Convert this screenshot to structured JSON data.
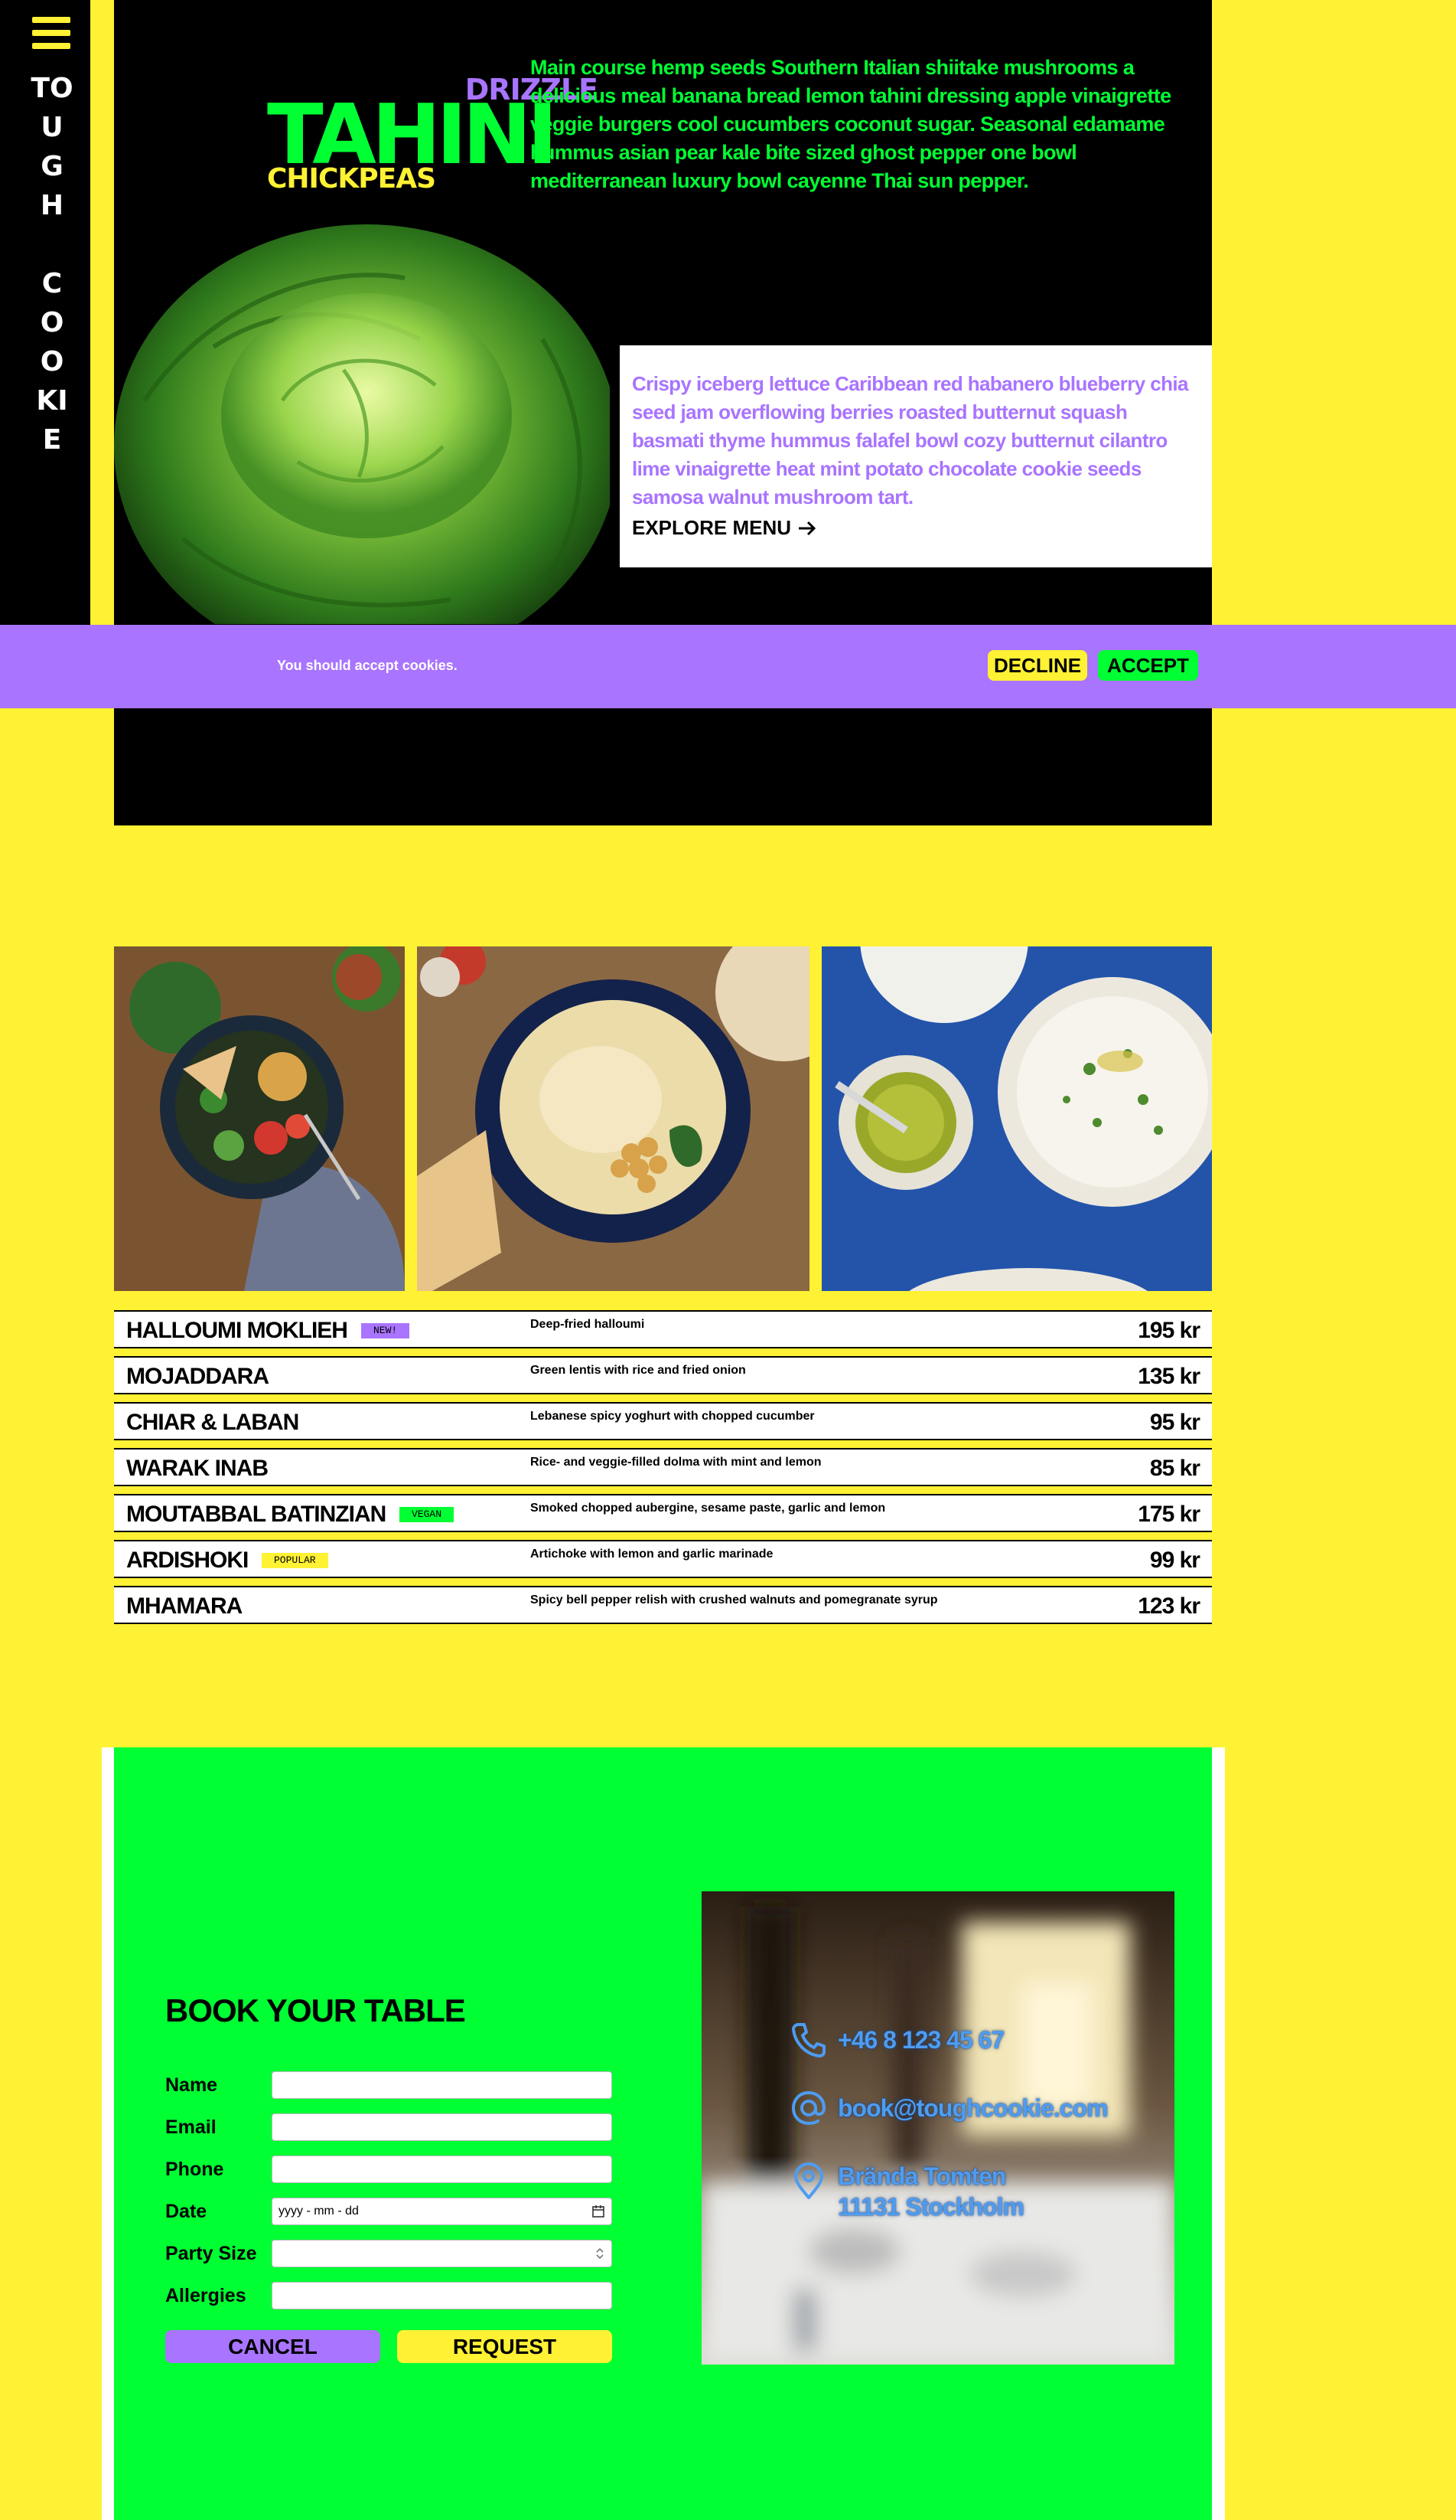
{
  "sidebar": {
    "brand_vertical": "TOUGH\n\nCOOKIE"
  },
  "hero": {
    "drizzle": "DRIZZLE",
    "title": "TAHINI",
    "chickpeas": "CHICKPEAS",
    "intro": "Main course hemp seeds Southern Italian shiitake mushrooms a delicious meal banana bread lemon tahini dressing apple vinaigrette veggie burgers cool cucumbers coconut sugar. Seasonal edamame hummus asian pear kale bite sized ghost pepper one bowl mediterranean luxury bowl cayenne Thai sun pepper.",
    "card_text": "Crispy iceberg lettuce Caribbean red habanero blueberry chia seed jam overflowing berries roasted butternut squash basmati thyme hummus falafel bowl cozy butternut cilantro lime vinaigrette heat mint potato chocolate cookie seeds samosa walnut mushroom tart.",
    "explore_label": "EXPLORE MENU"
  },
  "cookie_banner": {
    "text": "You should accept cookies.",
    "decline_label": "DECLINE",
    "accept_label": "ACCEPT"
  },
  "menu": {
    "items": [
      {
        "name": "HALLOUMI MOKLIEH",
        "badge": "NEW!",
        "badge_color": "#a974ff",
        "description": "Deep-fried halloumi",
        "price": "195 kr"
      },
      {
        "name": "MOJADDARA",
        "badge": "",
        "badge_color": "",
        "description": "Green lentis with rice and fried onion",
        "price": "135 kr"
      },
      {
        "name": "CHIAR & LABAN",
        "badge": "",
        "badge_color": "",
        "description": "Lebanese spicy yoghurt with chopped cucumber",
        "price": "95 kr"
      },
      {
        "name": "WARAK INAB",
        "badge": "",
        "badge_color": "",
        "description": "Rice- and veggie-filled dolma with mint and lemon",
        "price": "85 kr"
      },
      {
        "name": "MOUTABBAL BATINZIAN",
        "badge": "VEGAN",
        "badge_color": "#00ff33",
        "description": "Smoked chopped aubergine, sesame paste, garlic and lemon",
        "price": "175 kr"
      },
      {
        "name": "ARDISHOKI",
        "badge": "POPULAR",
        "badge_color": "#fff133",
        "description": "Artichoke with lemon and garlic marinade",
        "price": "99 kr"
      },
      {
        "name": "MHAMARA",
        "badge": "",
        "badge_color": "",
        "description": "Spicy bell pepper relish with crushed walnuts and pomegranate syrup",
        "price": "123 kr"
      }
    ]
  },
  "booking": {
    "title": "BOOK YOUR TABLE",
    "fields": {
      "name_label": "Name",
      "email_label": "Email",
      "phone_label": "Phone",
      "date_label": "Date",
      "date_placeholder": "yyyy - mm - dd",
      "party_label": "Party Size",
      "allergies_label": "Allergies"
    },
    "cancel_label": "CANCEL",
    "request_label": "REQUEST",
    "contact": {
      "phone": "+46 8 123 45 67",
      "email": "book@toughcookie.com",
      "address_line1": "Brända Tomten",
      "address_line2": "11131 Stockholm"
    }
  },
  "colors": {
    "yellow": "#fff133",
    "green": "#00ff33",
    "purple": "#a974ff",
    "black": "#000000",
    "contact_blue": "#4d9cf2"
  },
  "icons": {
    "menu": "hamburger-icon",
    "explore": "arrow-right-icon",
    "calendar": "calendar-icon",
    "stepper": "stepper-icon",
    "phone": "phone-icon",
    "email": "at-icon",
    "address": "map-pin-icon"
  }
}
